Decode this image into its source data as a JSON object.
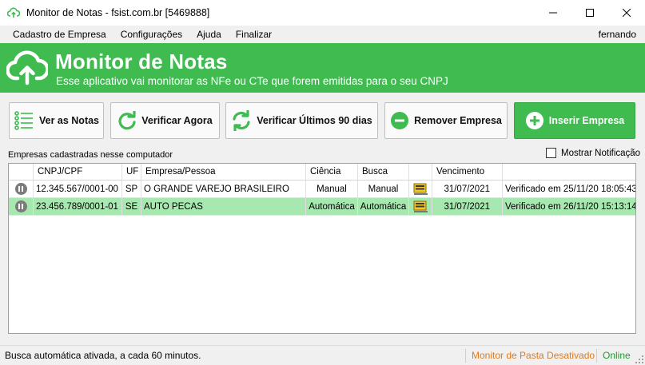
{
  "window": {
    "title": "Monitor de Notas - fsist.com.br [5469888]",
    "controls": [
      "minimize-icon",
      "maximize-icon",
      "close-icon"
    ]
  },
  "menu": {
    "items": [
      "Cadastro de Empresa",
      "Configurações",
      "Ajuda",
      "Finalizar"
    ],
    "user": "fernando"
  },
  "banner": {
    "title": "Monitor de Notas",
    "subtitle": "Esse aplicativo vai monitorar as NFe ou CTe que forem emitidas para o seu CNPJ",
    "color": "#3fbb50"
  },
  "toolbar": {
    "ver_notas": "Ver as Notas",
    "verificar_agora": "Verificar Agora",
    "verificar_90": "Verificar Últimos 90 dias",
    "remover_empresa": "Remover Empresa",
    "inserir_empresa": "Inserir Empresa"
  },
  "list": {
    "label": "Empresas cadastradas nesse computador",
    "show_notification_label": "Mostrar Notificação",
    "show_notification_checked": false,
    "headers": [
      "",
      "CNPJ/CPF",
      "UF",
      "Empresa/Pessoa",
      "Ciência",
      "Busca",
      "",
      "Vencimento",
      ""
    ],
    "rows": [
      {
        "cnpj": "12.345.567/0001-00",
        "uf": "SP",
        "empresa": "O GRANDE VAREJO BRASILEIRO",
        "ciencia": "Manual",
        "busca": "Manual",
        "vencimento": "31/07/2021",
        "status": "Verificado em 25/11/20 18:05:43",
        "selected": false
      },
      {
        "cnpj": "23.456.789/0001-01",
        "uf": "SE",
        "empresa": "AUTO PECAS",
        "ciencia": "Automática",
        "busca": "Automática",
        "vencimento": "31/07/2021",
        "status": "Verificado em 26/11/20 15:13:14",
        "selected": true
      }
    ]
  },
  "statusbar": {
    "left": "Busca automática ativada, a cada 60 minutos.",
    "monitor": "Monitor de Pasta Desativado",
    "online": "Online",
    "monitor_color": "#e07b1f",
    "online_color": "#1d9a2f"
  }
}
